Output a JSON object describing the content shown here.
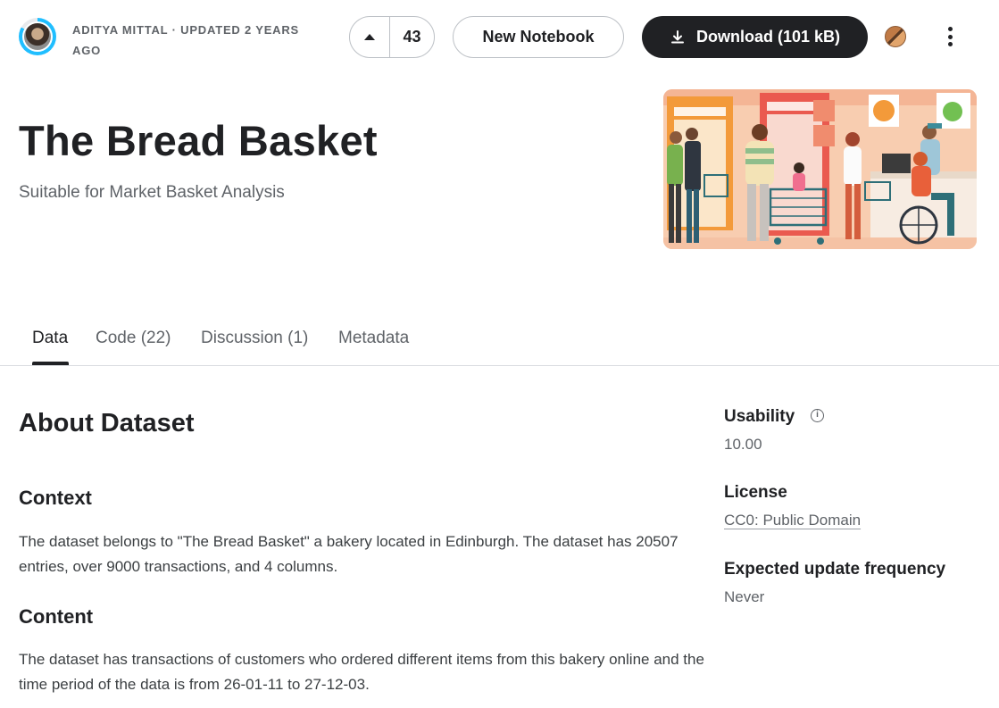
{
  "header": {
    "author_meta": "ADITYA MITTAL · UPDATED 2 YEARS AGO",
    "vote_count": "43",
    "new_notebook_label": "New Notebook",
    "download_label": "Download (101 kB)"
  },
  "dataset": {
    "title": "The Bread Basket",
    "subtitle": "Suitable for Market Basket Analysis"
  },
  "tabs": [
    {
      "label": "Data"
    },
    {
      "label": "Code (22)"
    },
    {
      "label": "Discussion (1)"
    },
    {
      "label": "Metadata"
    }
  ],
  "about": {
    "heading": "About Dataset",
    "context_heading": "Context",
    "context_text": "The dataset belongs to \"The Bread Basket\" a bakery located in Edinburgh. The dataset has 20507 entries, over 9000 transactions, and 4 columns.",
    "content_heading": "Content",
    "content_text": "The dataset has transactions of customers who ordered different items from this bakery online and the time period of the data is from 26-01-11 to 27-12-03."
  },
  "sidebar": {
    "usability_label": "Usability",
    "usability_value": "10.00",
    "license_label": "License",
    "license_value": "CC0: Public Domain",
    "frequency_label": "Expected update frequency",
    "frequency_value": "Never"
  },
  "icons": {
    "upvote": "triangle-up-icon",
    "download": "download-icon",
    "more": "more-vertical-icon",
    "info": "info-icon"
  },
  "colors": {
    "primary_dark": "#202124",
    "muted_text": "#5f6368",
    "border": "#bdc1c6",
    "avatar_ring": "#20beff"
  }
}
